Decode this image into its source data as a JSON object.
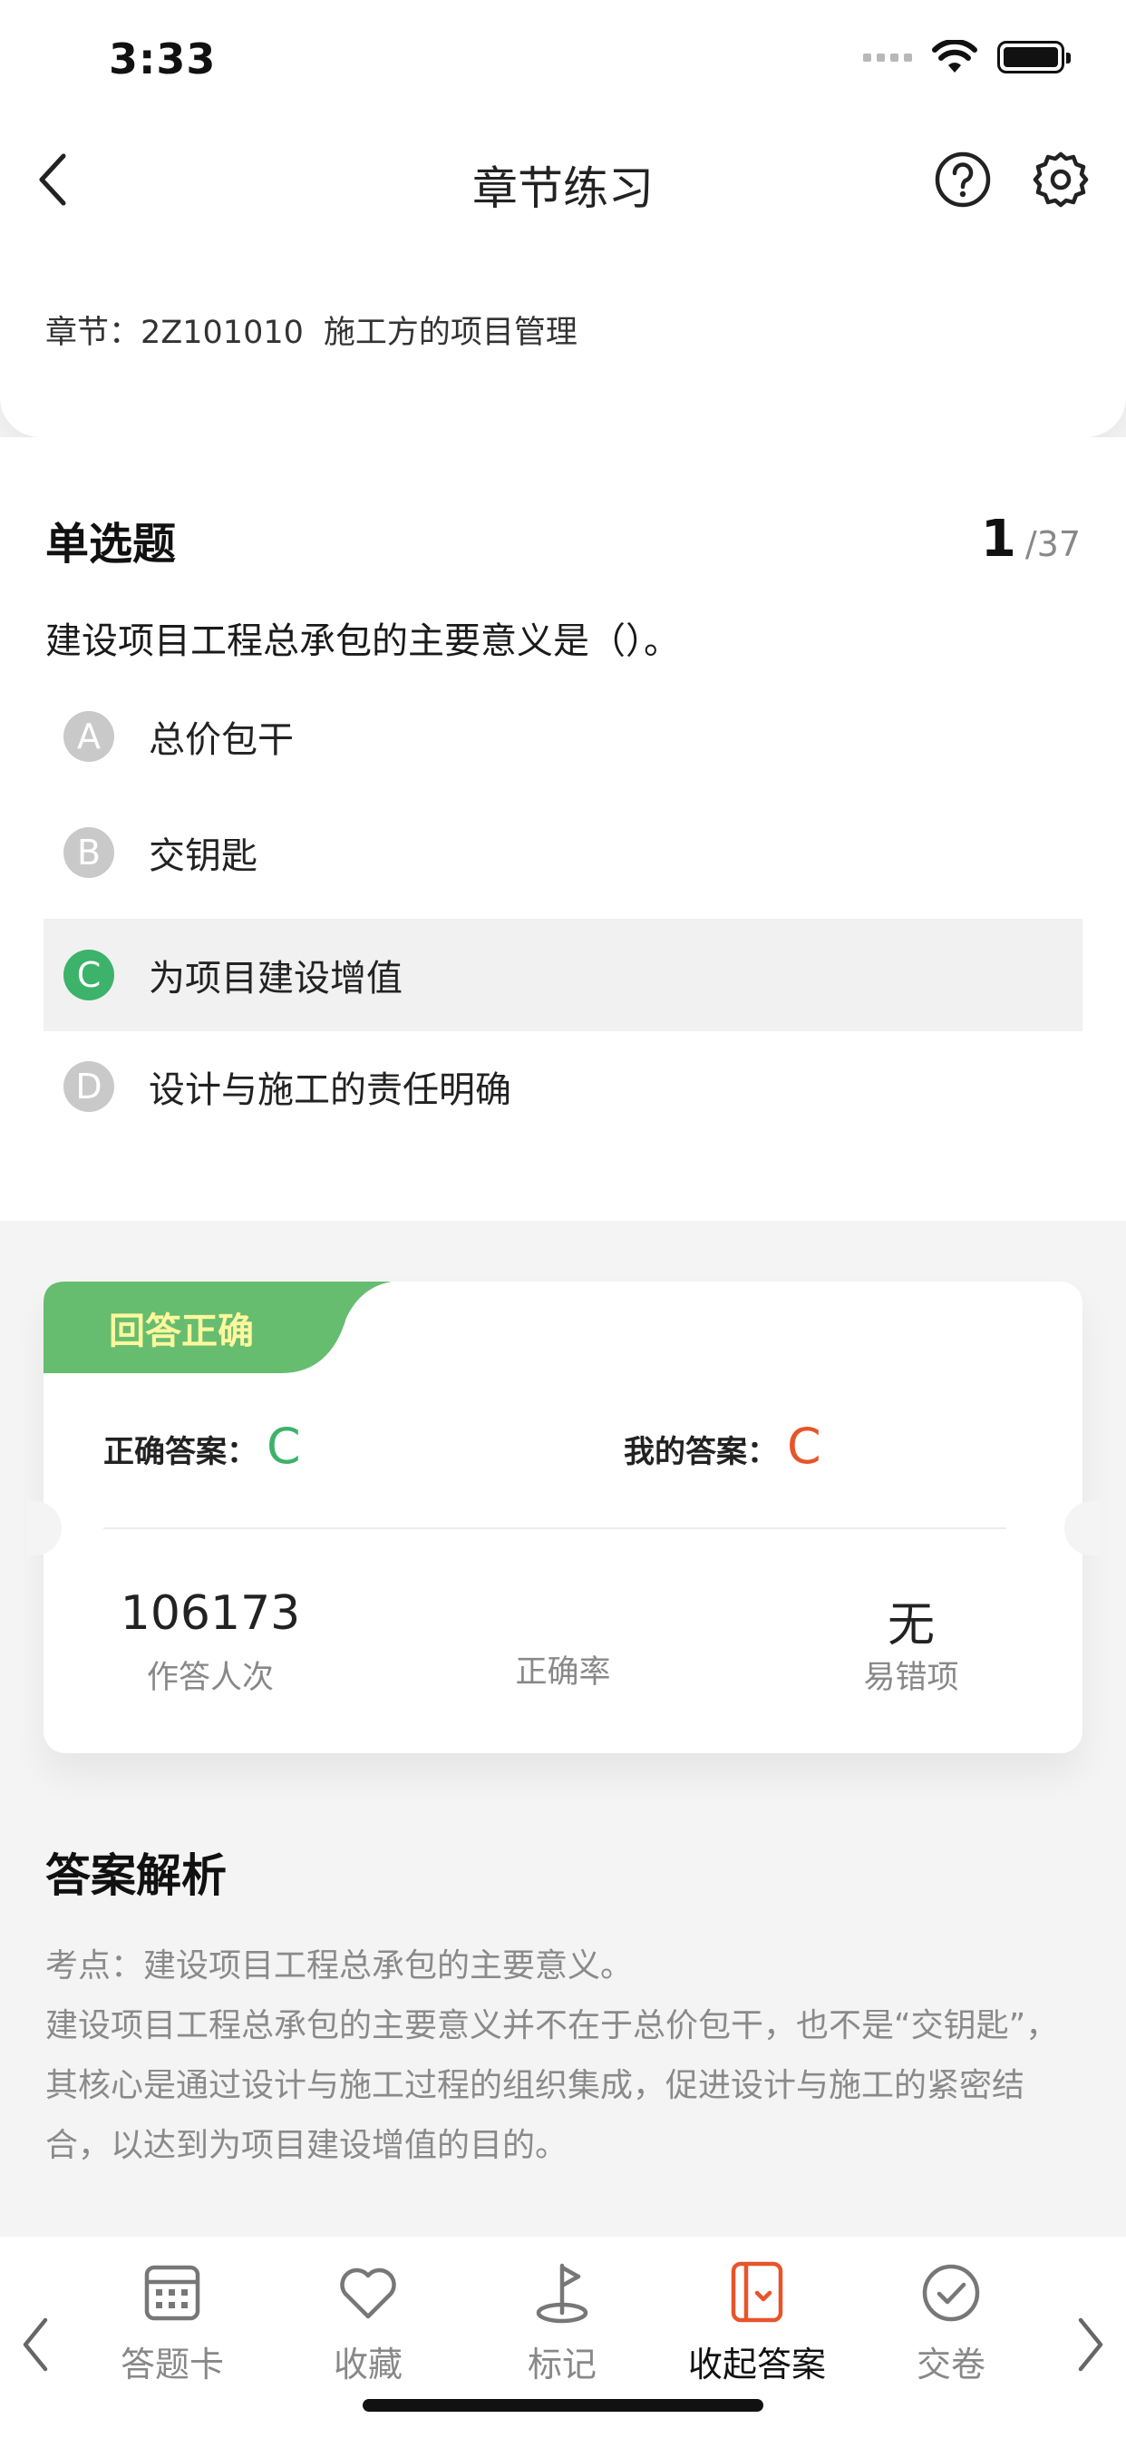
{
  "status_bar": {
    "time": "3:33"
  },
  "nav": {
    "title": "章节练习"
  },
  "chapter": {
    "prefix": "章节：",
    "code": "2Z101010",
    "name": "施工方的项目管理"
  },
  "question": {
    "type": "单选题",
    "current": "1",
    "total": "/37",
    "text": "建设项目工程总承包的主要意义是（）。",
    "options": [
      {
        "letter": "A",
        "text": "总价包干"
      },
      {
        "letter": "B",
        "text": "交钥匙"
      },
      {
        "letter": "C",
        "text": "为项目建设增值"
      },
      {
        "letter": "D",
        "text": "设计与施工的责任明确"
      }
    ],
    "selected": "C"
  },
  "result": {
    "tag": "回答正确",
    "correct_label": "正确答案：",
    "correct_value": "C",
    "mine_label": "我的答案：",
    "mine_value": "C",
    "stats": {
      "attempts_value": "106173",
      "attempts_label": "作答人次",
      "rate_value": "",
      "rate_label": "正确率",
      "error_value": "无",
      "error_label": "易错项"
    }
  },
  "analysis": {
    "title": "答案解析",
    "lines": [
      "考点：建设项目工程总承包的主要意义。",
      "建设项目工程总承包的主要意义并不在于总价包干，也不是“交钥匙”，",
      "其核心是通过设计与施工过程的组织集成，促进设计与施工的紧密结",
      "合，以达到为项目建设增值的目的。"
    ]
  },
  "bottom_bar": {
    "items": [
      {
        "label": "答题卡",
        "icon": "answer-card-icon"
      },
      {
        "label": "收藏",
        "icon": "heart-icon"
      },
      {
        "label": "标记",
        "icon": "flag-icon"
      },
      {
        "label": "收起答案",
        "icon": "collapse-answer-icon"
      },
      {
        "label": "交卷",
        "icon": "submit-check-icon"
      }
    ]
  },
  "colors": {
    "correct": "#3cb26a",
    "mine": "#e8542a",
    "tag_bg": "#66bd6f",
    "tag_text": "#fff79d",
    "active_icon": "#e8542a"
  }
}
